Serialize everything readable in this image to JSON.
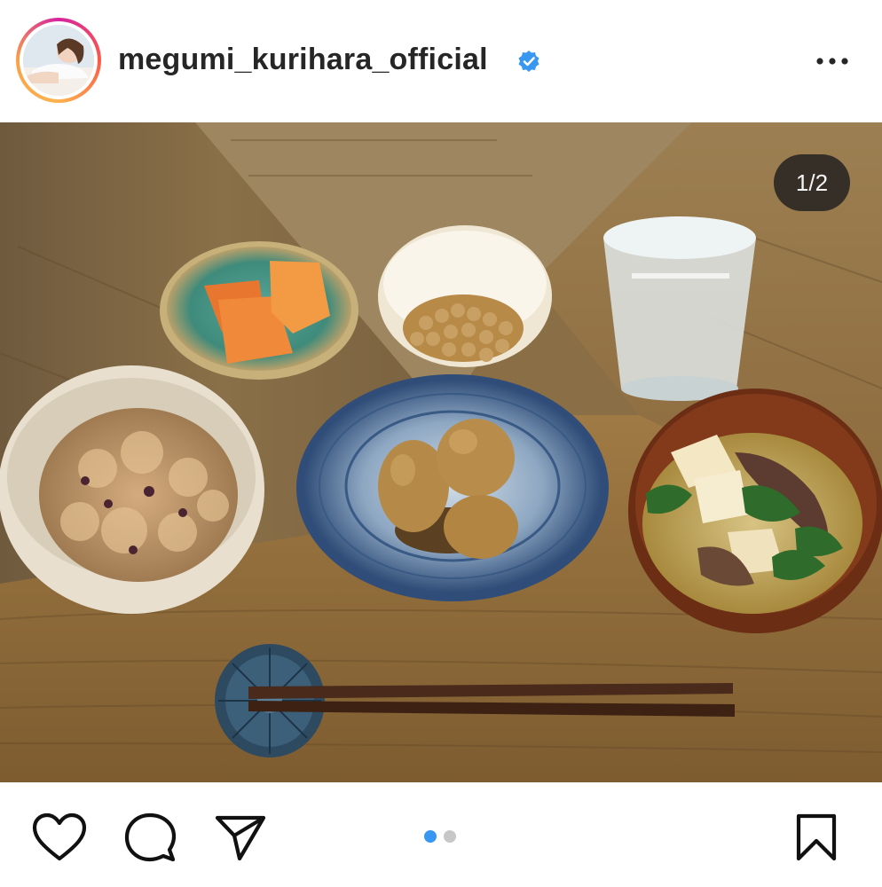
{
  "post": {
    "username": "megumi_kurihara_official",
    "verified": true,
    "verified_icon": "verified-badge-icon",
    "more_icon": "more-options-icon"
  },
  "carousel": {
    "counter": "1/2",
    "current": 1,
    "total": 2,
    "active_dot_color": "#3897f0",
    "inactive_dot_color": "#c7c7c7"
  },
  "actions": {
    "like_icon": "heart-icon",
    "comment_icon": "comment-bubble-icon",
    "share_icon": "paper-plane-icon",
    "save_icon": "bookmark-icon"
  },
  "colors": {
    "text": "#262626",
    "verified_blue": "#3897f0"
  }
}
